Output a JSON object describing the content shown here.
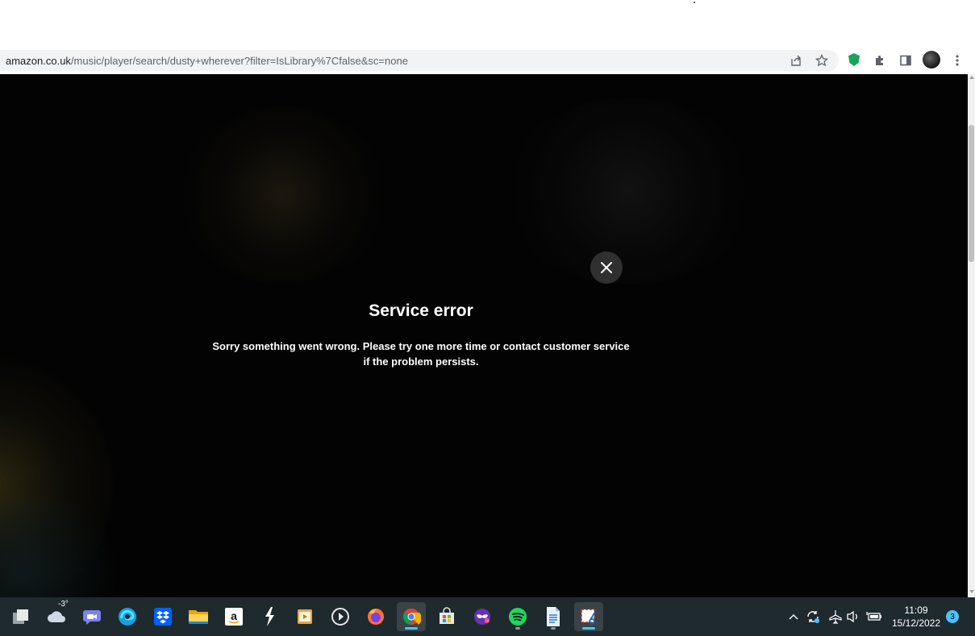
{
  "browser": {
    "url_host": "amazon.co.uk",
    "url_path": "/music/player/search/dusty+wherever?filter=IsLibrary%7Cfalse&sc=none",
    "toolbar_icons": [
      "share-icon",
      "star-icon",
      "shield-extension-icon",
      "puzzle-extensions-icon",
      "side-panel-icon",
      "profile-avatar",
      "kebab-menu-icon"
    ]
  },
  "dialog": {
    "title": "Service error",
    "message_line1": "Sorry something went wrong. Please try one more time or contact customer service",
    "message_line2": "if the problem persists.",
    "close_icon": "close-icon"
  },
  "taskbar": {
    "weather_temp": "-3°",
    "apps": [
      "task-view",
      "weather",
      "teams-chat",
      "edge",
      "dropbox",
      "file-explorer",
      "amazon",
      "winamp-bolt",
      "vlc-player",
      "media-player",
      "firefox",
      "chrome",
      "microsoft-store",
      "mask-app",
      "spotify",
      "notepad-document",
      "snipping-tool"
    ],
    "clock_time": "11:09",
    "clock_date": "15/12/2022",
    "notification_count": "3"
  },
  "colors": {
    "page_background": "#030303",
    "close_button_bg": "#303030",
    "taskbar_bg": "#1f2a2e",
    "accent": "#4cc2ff"
  }
}
